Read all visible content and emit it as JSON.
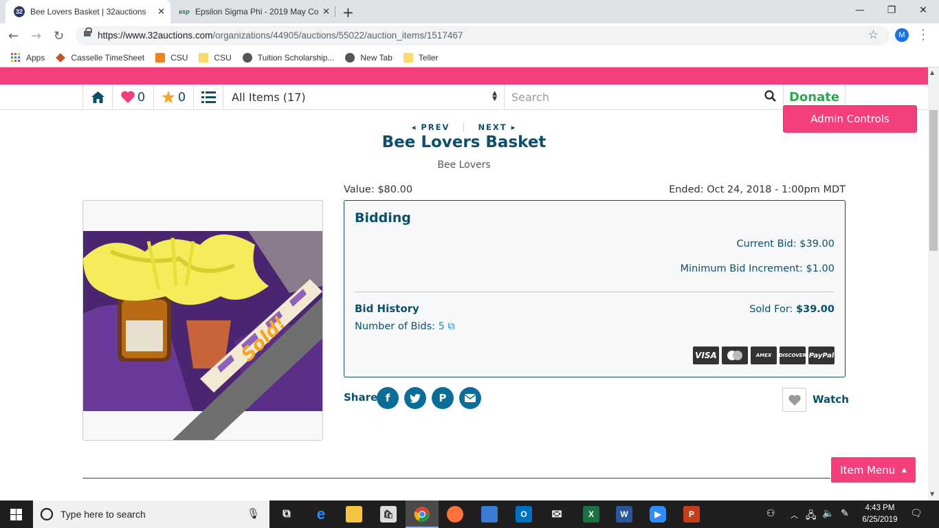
{
  "browser": {
    "tabs": [
      {
        "title": "Bee Lovers Basket | 32auctions",
        "favicon": "32auctions-icon"
      },
      {
        "title": "Epsilon Sigma Phi - 2019 May Co",
        "favicon": "esp-icon"
      }
    ],
    "url_host": "https://www.32auctions.com",
    "url_path": "/organizations/44905/auctions/55022/auction_items/1517467",
    "profile_initial": "M",
    "bookmarks": [
      "Apps",
      "Casselle TimeSheet",
      "CSU",
      "CSU",
      "Tuition Scholarship...",
      "New Tab",
      "Teller"
    ]
  },
  "nav": {
    "favorites_count": "0",
    "starred_count": "0",
    "category_select": "All Items (17)",
    "search_placeholder": "Search",
    "donate_label": "Donate",
    "admin_label": "Admin Controls"
  },
  "item": {
    "prev_label": "PREV",
    "next_label": "NEXT",
    "title": "Bee Lovers Basket",
    "donor": "Bee Lovers",
    "value": "Value: $80.00",
    "ended": "Ended: Oct 24, 2018 - 1:00pm MDT",
    "sold_ribbon": "Sold!"
  },
  "bidding": {
    "heading": "Bidding",
    "current_bid": "Current Bid: $39.00",
    "min_increment": "Minimum Bid Increment: $1.00",
    "history_heading": "Bid History",
    "num_bids_label": "Number of Bids: ",
    "num_bids": "5",
    "sold_for_label": "Sold For: ",
    "sold_for_value": "$39.00",
    "cards": [
      "VISA",
      "MC",
      "AMEX",
      "DISCOVER",
      "PayPal"
    ]
  },
  "share": {
    "label": "Share",
    "watch_label": "Watch",
    "item_menu_label": "Item Menu"
  },
  "taskbar": {
    "search_placeholder": "Type here to search",
    "time": "4:43 PM",
    "date": "6/25/2019"
  },
  "colors": {
    "brand_pink": "#f43f7a",
    "brand_navy": "#0b4f6c",
    "donate_green": "#2ea84a"
  }
}
